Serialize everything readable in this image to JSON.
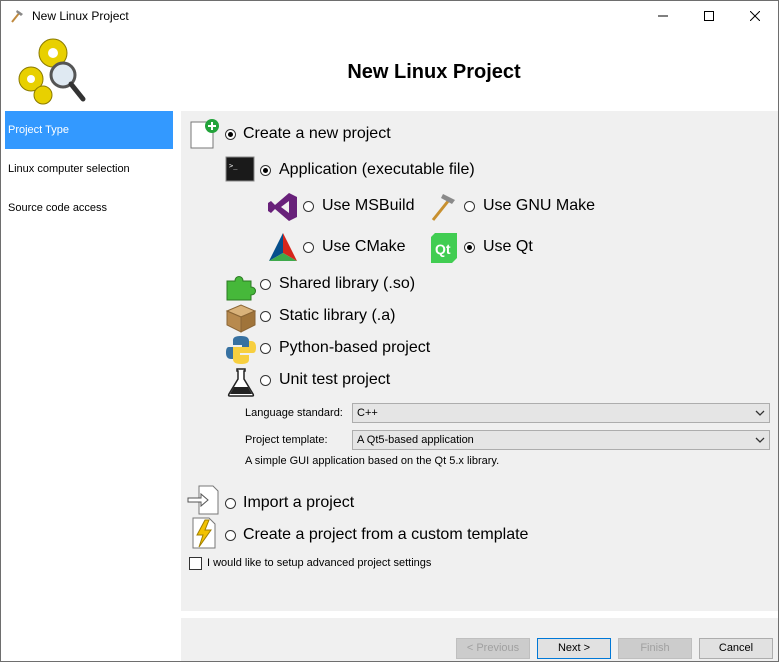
{
  "window": {
    "title": "New Linux Project"
  },
  "header": {
    "heading": "New Linux Project"
  },
  "sidebar": {
    "items": [
      {
        "label": "Project Type"
      },
      {
        "label": "Linux computer selection"
      },
      {
        "label": "Source code access"
      }
    ]
  },
  "main": {
    "create_new": "Create a new project",
    "application": "Application (executable file)",
    "use_msbuild": "Use MSBuild",
    "use_gnu_make": "Use GNU Make",
    "use_cmake": "Use CMake",
    "use_qt": "Use Qt",
    "shared_library": "Shared library (.so)",
    "static_library": "Static library (.a)",
    "python_project": "Python-based project",
    "unit_test": "Unit test project",
    "language_standard_label": "Language standard:",
    "language_standard_value": "C++",
    "project_template_label": "Project template:",
    "project_template_value": "A Qt5-based application",
    "template_description": "A simple GUI application based on the Qt 5.x library.",
    "import_project": "Import a project",
    "custom_template": "Create a project from a custom template",
    "advanced_settings": "I would like to setup advanced project settings"
  },
  "footer": {
    "previous": "< Previous",
    "next": "Next >",
    "finish": "Finish",
    "cancel": "Cancel"
  },
  "colors": {
    "accent": "#3399ff",
    "panel": "#f0f0f0",
    "qt_green": "#41cd52",
    "vs_purple": "#68217a"
  }
}
